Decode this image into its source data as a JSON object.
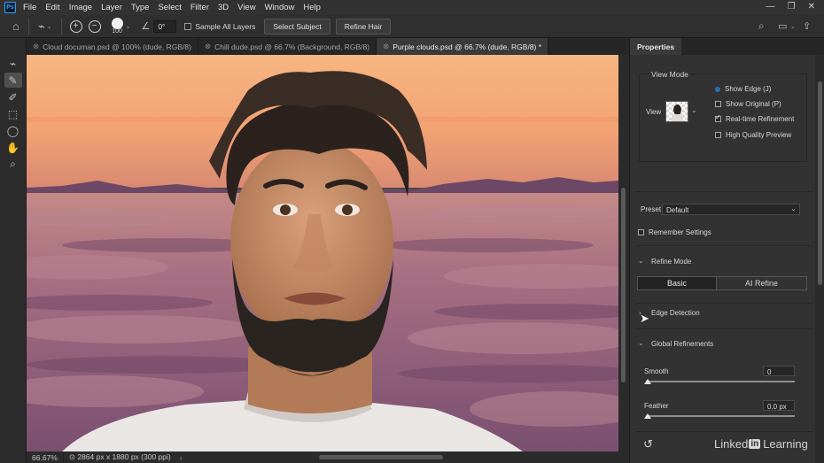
{
  "app": {
    "logo": "Ps"
  },
  "menu": [
    "File",
    "Edit",
    "Image",
    "Layer",
    "Type",
    "Select",
    "Filter",
    "3D",
    "View",
    "Window",
    "Help"
  ],
  "window_controls": [
    "—",
    "❐",
    "✕"
  ],
  "options": {
    "brush_size": "100",
    "angle": "0°",
    "sample_all_layers": "Sample All Layers",
    "select_subject": "Select Subject",
    "refine_hair": "Refine Hair",
    "plus": "+",
    "minus": "−"
  },
  "tabs": [
    {
      "label": "Cloud documan.psd @ 100% (dude, RGB/8)",
      "close": "⊗"
    },
    {
      "label": "Chill dude.psd @ 66.7% (Background, RGB/8)",
      "close": "⊗"
    },
    {
      "label": "Purple clouds.psd @ 66.7% (dude, RGB/8) *",
      "close": "⊗"
    }
  ],
  "status": {
    "zoom": "66.67%",
    "info": "2864 px x 1880 px (300 ppi)"
  },
  "properties": {
    "title": "Properties",
    "view_mode": {
      "heading": "View Mode",
      "view_label": "View",
      "show_edge": "Show Edge (J)",
      "show_original": "Show Original (P)",
      "realtime": "Real-time Refinement",
      "hq_preview": "High Quality Preview"
    },
    "preset": {
      "label": "Preset",
      "value": "Default"
    },
    "remember": "Remember Settings",
    "refine_mode": {
      "heading": "Refine Mode",
      "basic": "Basic",
      "ai": "AI Refine"
    },
    "edge_detection": "Edge Detection",
    "global": {
      "heading": "Global Refinements",
      "smooth_label": "Smooth",
      "smooth_value": "0",
      "feather_label": "Feather",
      "feather_value": "0.0 px"
    },
    "reset_icon": "reset-icon"
  },
  "watermark": {
    "before": "Linked",
    "in": "in",
    "after": " Learning"
  },
  "colors": {
    "accent": "#31a8ff",
    "panel": "#323232",
    "sky_top": "#f6b682",
    "cloud": "#8f5f78"
  }
}
